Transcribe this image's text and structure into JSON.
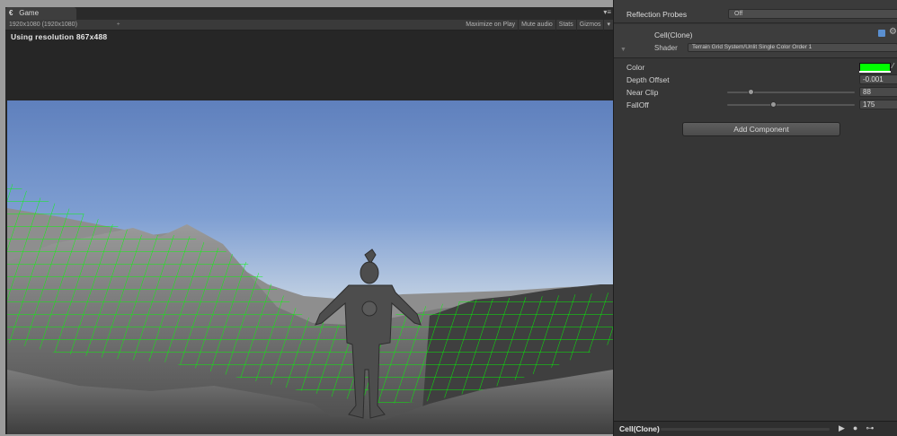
{
  "game": {
    "tab_label": "Game",
    "tab_glyph": "€",
    "panel_menu": "▾≡",
    "resolution_dropdown": "1920x1080 (1920x1080)",
    "dropdown_arrow": "÷",
    "buttons": [
      "Maximize on Play",
      "Mute audio",
      "Stats",
      "Gizmos"
    ],
    "gizmos_arrow": "▾",
    "resolution_label": "Using resolution 867x488"
  },
  "inspector": {
    "reflection_probes": {
      "label": "Reflection Probes",
      "value": "Off"
    },
    "material": {
      "name": "Cell(Clone)",
      "shader_label": "Shader",
      "shader_value": "Terrain Grid System/Unlit Single Color Order 1"
    },
    "properties": [
      {
        "label": "Color",
        "type": "color",
        "value": "#00ff00"
      },
      {
        "label": "Depth Offset",
        "type": "number",
        "value": "-0.001"
      },
      {
        "label": "Near Clip",
        "type": "slider",
        "value": "88",
        "fraction": 0.18
      },
      {
        "label": "FallOff",
        "type": "slider",
        "value": "175",
        "fraction": 0.36
      }
    ],
    "add_component_label": "Add Component",
    "preview": {
      "name": "Cell(Clone)",
      "icons": [
        "▶",
        "●",
        "⊶"
      ]
    }
  },
  "colors": {
    "grid": "#00ff00",
    "panel": "#363636",
    "sky_top": "#5f80bd",
    "sky_bottom": "#f3ecdb"
  }
}
